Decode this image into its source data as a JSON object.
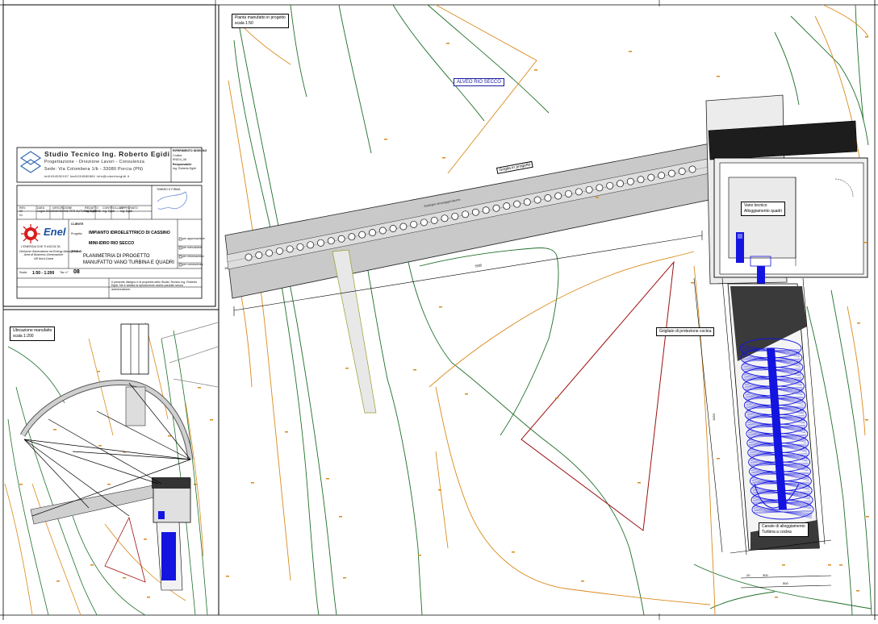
{
  "colors": {
    "contour_green": "#1f6f2a",
    "contour_orange": "#d98a1c",
    "red_outline": "#9c1010",
    "turbine_blue": "#1414e0",
    "concrete_grey": "#c8c8c8",
    "dark_grey": "#3a3a3a",
    "enel_red": "#d61f1f"
  },
  "title_block": {
    "studio_name": "Studio Tecnico Ing. Roberto Egidi",
    "studio_services": "Progettazione - Direzione Lavori - Consulenza",
    "studio_address": "Sede: Via Colombera 1/b - 33080 Porcia (PN)",
    "studio_contacts": "tel0434530157   fax0434580881   info@robertoegidi.it",
    "right_small": [
      "RIFERIMENTO DISEGNO",
      "Codice:",
      "EN014_06",
      "Responsabile",
      "Ing. Roberto Egidi"
    ],
    "enel_logo": "Enel",
    "enel_sub": "L'ENERGIA CHE TI ASCOLTA.",
    "enel_division": [
      "Divisione Generazione ed Energy Management",
      "Area di Business Generazione",
      "UB Nord-Ovest"
    ],
    "client_label": "CLIENTE",
    "project_label": "Progetto",
    "project_value": "IMPIANTO IDROELETTRICO DI CASSINO",
    "plant_value": "MINI-IDRO RIO SECCO",
    "title_label": "TITOLO",
    "title_line1": "PLANIMETRIA DI PROGETTO",
    "title_line2": "MANUFATTO VANO TURBINA E QUADRI",
    "scale_label": "Scala",
    "scale_value": "1:50 - 1:200",
    "sheet_label": "Tav. n°",
    "sheet_value": "08",
    "checkbox_labels": [
      "per approvazione",
      "per esecuzione",
      "per informazione",
      "per conoscenza"
    ],
    "rev_headers": [
      "REV.",
      "DATA",
      "DESCRIZIONE",
      "REDATTO",
      "CONTROLLATO",
      "APPROVATO"
    ],
    "rev_rows": [
      [
        "00",
        "Luglio 2013",
        "EMISSIONE PER AUTORIZZAZIONE",
        "Ing. Egidi",
        "Ing. Egidi",
        "Ing. Egidi"
      ],
      [
        "01",
        "",
        "",
        "",
        "",
        ""
      ]
    ],
    "disclaimer": "Il presente disegno è di proprietà dello Studio Tecnico Ing. Roberto Egidi. Ne è vietata la riproduzione anche parziale senza autorizzazione.",
    "stamp": "TIMBRO E FIRMA"
  },
  "main_plan": {
    "title": "Pianta manufatto in progetto",
    "scale": "scala 1:50",
    "riverbed_label": "ALVEO RIO SECCO",
    "grate_label": "Griglia in progetto",
    "grate_pipe_label": "Sostegno ancoraggio bitume",
    "tech_room_label": [
      "Vano tecnico",
      "Alloggiamento quadri"
    ],
    "protection_grate_label": "Grigliato di protezione coclea",
    "channel_label": [
      "Canale di alloggiamento",
      "Turbina a coclea"
    ],
    "dim_labels": [
      "7500",
      "1150",
      "500",
      "300",
      "20",
      "15"
    ]
  },
  "location_plan": {
    "title": "Ubicazione manufatto",
    "scale": "scala 1:200"
  }
}
